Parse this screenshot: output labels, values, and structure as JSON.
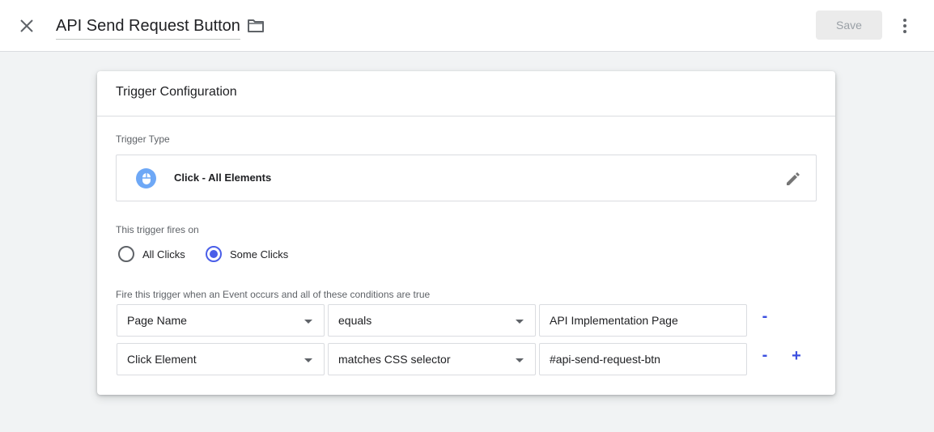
{
  "header": {
    "title": "API Send Request Button",
    "save_label": "Save"
  },
  "card": {
    "title": "Trigger Configuration",
    "trigger_type_label": "Trigger Type",
    "trigger_type": "Click - All Elements",
    "fires_on_label": "This trigger fires on",
    "radio_options": [
      {
        "label": "All Clicks",
        "checked": false
      },
      {
        "label": "Some Clicks",
        "checked": true
      }
    ],
    "conditions_label": "Fire this trigger when an Event occurs and all of these conditions are true",
    "conditions": [
      {
        "variable": "Page Name",
        "operator": "equals",
        "value": "API Implementation Page",
        "remove_label": "-",
        "add_label": ""
      },
      {
        "variable": "Click Element",
        "operator": "matches CSS selector",
        "value": "#api-send-request-btn",
        "remove_label": "-",
        "add_label": "+"
      }
    ]
  },
  "icons": {
    "close": "close-icon",
    "folder": "folder-icon",
    "more": "more-vert-icon",
    "mouse": "mouse-icon",
    "edit": "pencil-icon"
  },
  "colors": {
    "accent": "#4a5ee8",
    "trigger_icon_bg": "#6ea8f6",
    "save_disabled_bg": "#ebebeb"
  }
}
